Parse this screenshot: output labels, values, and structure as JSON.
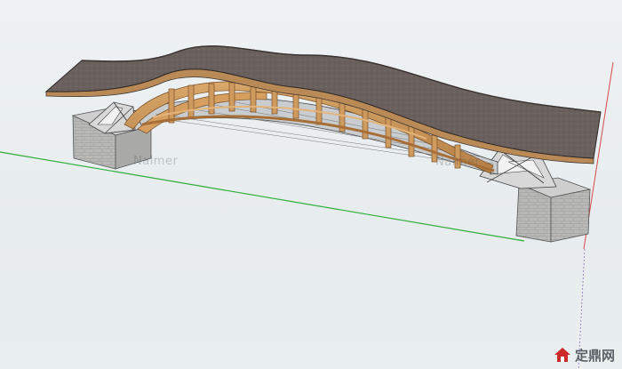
{
  "watermarks": {
    "model_left": "Nalmer",
    "model_right": "Nalmer"
  },
  "site_mark": {
    "text": "定鼎网",
    "icon": "house-logo-icon",
    "colors": {
      "icon_red": "#cc2a2a",
      "text_gray": "#5b6166"
    }
  },
  "axes": {
    "green_axis_color": "#2fae39",
    "red_axis_color": "#d84a4a"
  },
  "model": {
    "roof_color": "#6d6260",
    "wood_color": "#c9945a",
    "stone_color": "#b6b6b6"
  }
}
